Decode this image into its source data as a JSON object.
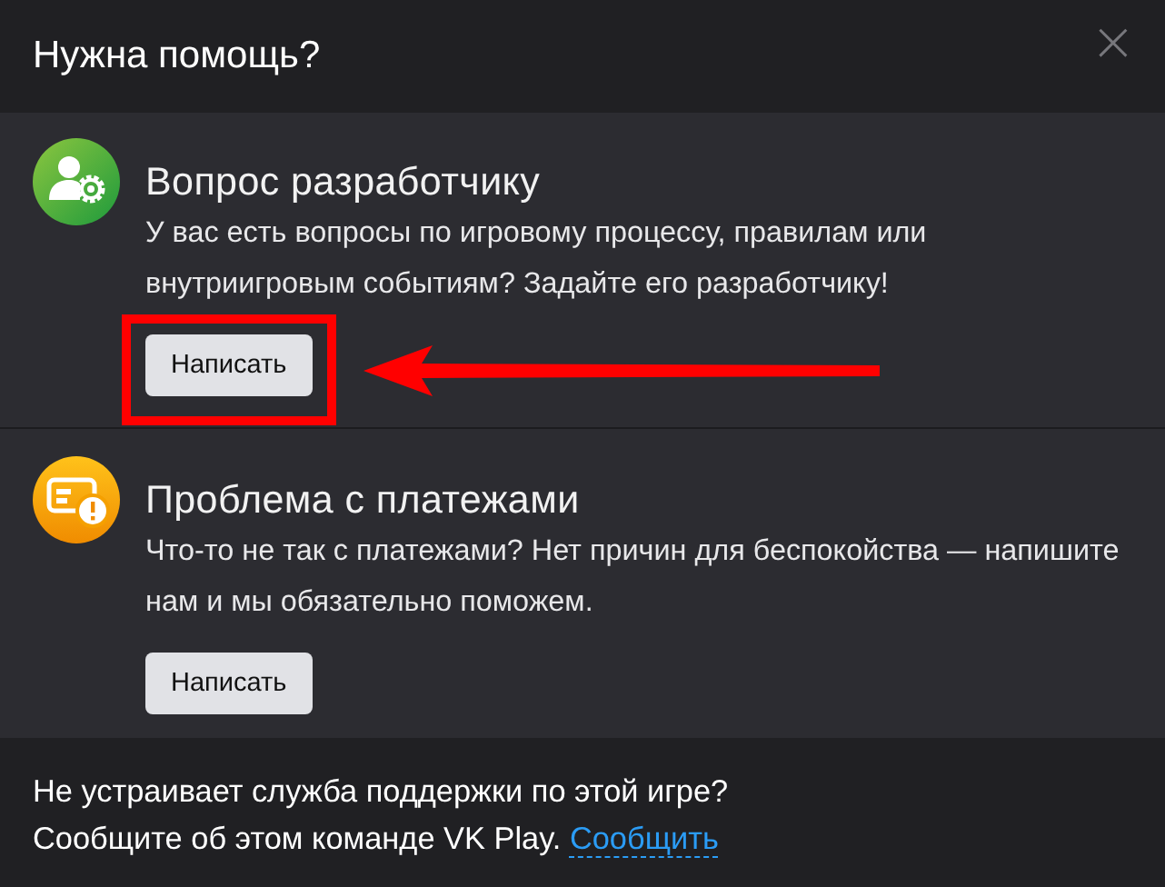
{
  "dialog": {
    "title": "Нужна помощь?",
    "close": "×"
  },
  "sections": [
    {
      "kind": "developer",
      "title": "Вопрос разработчику",
      "text": "У вас есть вопросы по игровому процессу, правилам или внутриигровым событиям? Задайте его разработчику!",
      "button": "Написать",
      "highlighted": true
    },
    {
      "kind": "payment",
      "title": "Проблема с платежами",
      "text": "Что-то не так с платежами? Нет причин для беспокойства — напишите нам и мы обязательно поможем.",
      "button": "Написать",
      "highlighted": false
    }
  ],
  "footer": {
    "question": "Не устраивает служба поддержки по этой игре?",
    "text": "Сообщите об этом команде VK Play.",
    "link": "Сообщить"
  }
}
